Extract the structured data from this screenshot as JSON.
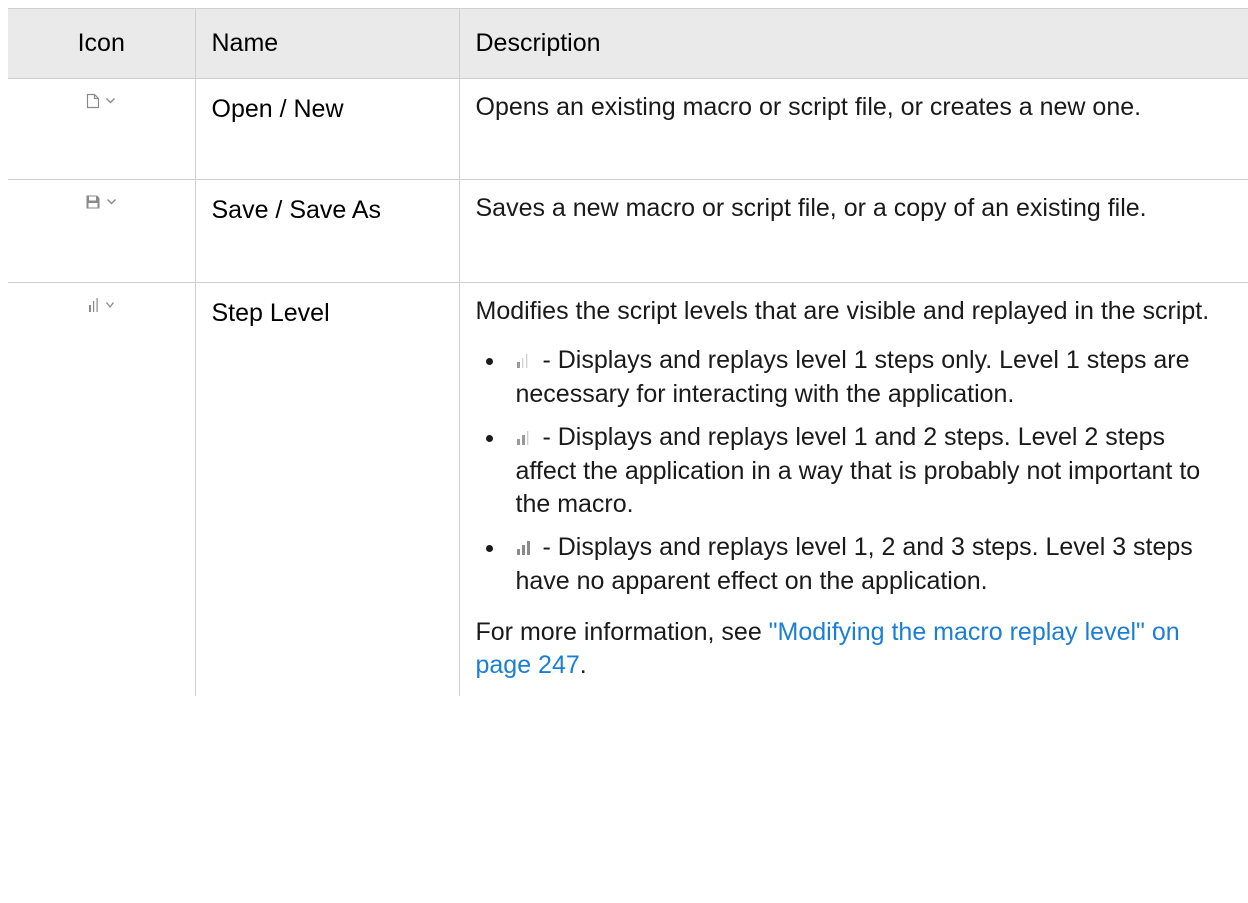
{
  "table": {
    "headers": {
      "icon": "Icon",
      "name": "Name",
      "description": "Description"
    },
    "rows": [
      {
        "icon": "new-file-icon",
        "name": "Open / New",
        "description": "Opens an existing macro or script file, or creates a new one."
      },
      {
        "icon": "save-icon",
        "name": "Save / Save As",
        "description": "Saves a new macro or script file, or a copy of an existing file."
      },
      {
        "icon": "step-level-icon",
        "name": "Step Level",
        "description": "Modifies the script levels that are visible and replayed in the script.",
        "levels": [
          {
            "icon": "level-1-icon",
            "text": " - Displays and replays level 1 steps only. Level 1 steps are necessary for interacting with the application."
          },
          {
            "icon": "level-2-icon",
            "text": " - Displays and replays level 1 and 2 steps. Level 2 steps affect the application in a way that is probably not important to the macro."
          },
          {
            "icon": "level-3-icon",
            "text": " - Displays and replays level 1, 2 and 3 steps. Level 3 steps have no apparent effect on the application."
          }
        ],
        "more_prefix": "For more information, see ",
        "more_link": "\"Modifying the macro replay level\" on page 247",
        "more_suffix": "."
      }
    ]
  },
  "colors": {
    "header_bg": "#eaeaea",
    "border": "#cfcfcf",
    "link": "#1a7fd4",
    "icon_gray": "#8a8a8a"
  }
}
